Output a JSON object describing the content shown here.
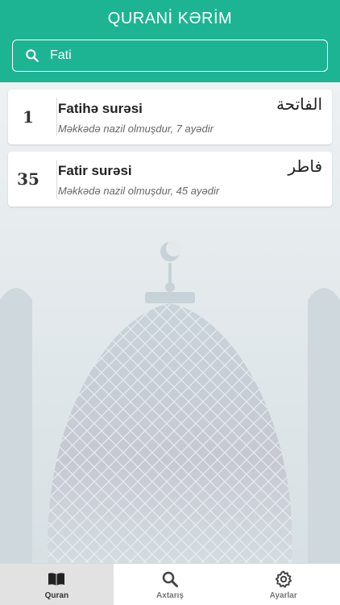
{
  "header": {
    "title": "QURANİ KƏRİM",
    "background_color": "#1db493"
  },
  "search": {
    "value": "Fati",
    "icon": "search-icon"
  },
  "results": [
    {
      "number": "1",
      "title": "Fatihə surəsi",
      "subtitle": "Məkkədə nazil olmuşdur, 7 ayədir",
      "arabic": "الفاتحة"
    },
    {
      "number": "35",
      "title": "Fatir surəsi",
      "subtitle": "Məkkədə nazil olmuşdur, 45 ayədir",
      "arabic": "فاطر"
    }
  ],
  "tabbar": {
    "tabs": [
      {
        "label": "Quran",
        "icon": "book-icon",
        "active": true
      },
      {
        "label": "Axtarış",
        "icon": "search-icon",
        "active": false
      },
      {
        "label": "Ayarlar",
        "icon": "gear-icon",
        "active": false
      }
    ]
  }
}
